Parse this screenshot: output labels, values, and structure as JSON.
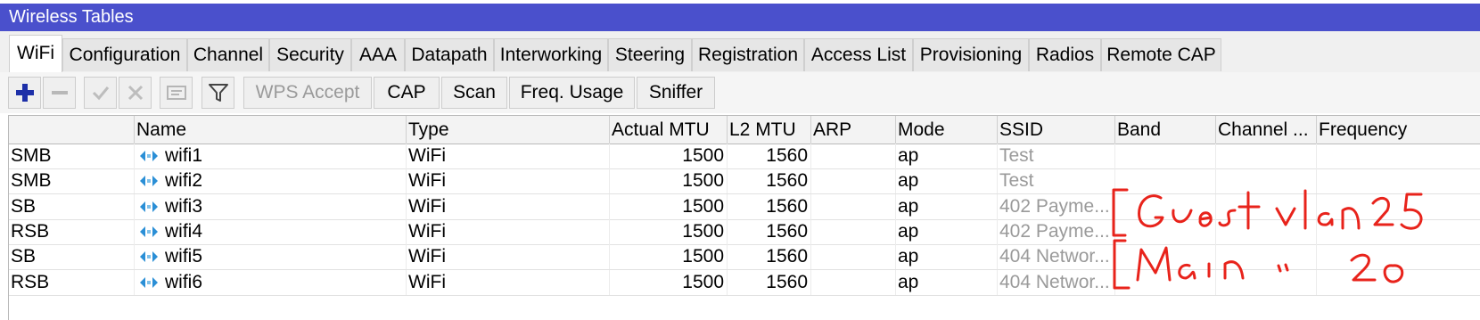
{
  "window": {
    "title": "Wireless Tables"
  },
  "tabs": [
    {
      "label": "WiFi",
      "active": true
    },
    {
      "label": "Configuration"
    },
    {
      "label": "Channel"
    },
    {
      "label": "Security"
    },
    {
      "label": "AAA"
    },
    {
      "label": "Datapath"
    },
    {
      "label": "Interworking"
    },
    {
      "label": "Steering"
    },
    {
      "label": "Registration"
    },
    {
      "label": "Access List"
    },
    {
      "label": "Provisioning"
    },
    {
      "label": "Radios"
    },
    {
      "label": "Remote CAP"
    }
  ],
  "toolbar": {
    "add_icon": "plus-icon",
    "remove_icon": "minus-icon",
    "enable_icon": "check-icon",
    "disable_icon": "x-icon",
    "comment_icon": "comment-icon",
    "filter_icon": "filter-icon",
    "wps_accept": "WPS Accept",
    "cap": "CAP",
    "scan": "Scan",
    "freq_usage": "Freq. Usage",
    "sniffer": "Sniffer"
  },
  "table": {
    "columns": [
      "",
      "Name",
      "Type",
      "Actual MTU",
      "L2 MTU",
      "ARP",
      "Mode",
      "SSID",
      "Band",
      "Channel ...",
      "Frequency"
    ],
    "rows": [
      {
        "flags": "SMB",
        "name": "wifi1",
        "type": "WiFi",
        "actual_mtu": "1500",
        "l2_mtu": "1560",
        "arp": "",
        "mode": "ap",
        "ssid": "Test",
        "band": "",
        "channel": "",
        "frequency": ""
      },
      {
        "flags": "SMB",
        "name": "wifi2",
        "type": "WiFi",
        "actual_mtu": "1500",
        "l2_mtu": "1560",
        "arp": "",
        "mode": "ap",
        "ssid": "Test",
        "band": "",
        "channel": "",
        "frequency": ""
      },
      {
        "flags": "SB",
        "name": "wifi3",
        "type": "WiFi",
        "actual_mtu": "1500",
        "l2_mtu": "1560",
        "arp": "",
        "mode": "ap",
        "ssid": "402 Payme...",
        "band": "",
        "channel": "",
        "frequency": ""
      },
      {
        "flags": "RSB",
        "name": "wifi4",
        "type": "WiFi",
        "actual_mtu": "1500",
        "l2_mtu": "1560",
        "arp": "",
        "mode": "ap",
        "ssid": "402 Payme...",
        "band": "",
        "channel": "",
        "frequency": ""
      },
      {
        "flags": "SB",
        "name": "wifi5",
        "type": "WiFi",
        "actual_mtu": "1500",
        "l2_mtu": "1560",
        "arp": "",
        "mode": "ap",
        "ssid": "404 Networ...",
        "band": "",
        "channel": "",
        "frequency": ""
      },
      {
        "flags": "RSB",
        "name": "wifi6",
        "type": "WiFi",
        "actual_mtu": "1500",
        "l2_mtu": "1560",
        "arp": "",
        "mode": "ap",
        "ssid": "404 Networ...",
        "band": "",
        "channel": "",
        "frequency": ""
      }
    ]
  },
  "annotation": {
    "color": "#e8231b",
    "line1": "Guest vlan 25",
    "line2": "Main \" 20"
  },
  "colors": {
    "titlebar": "#4a50cc",
    "add_icon": "#1d2fa8"
  }
}
